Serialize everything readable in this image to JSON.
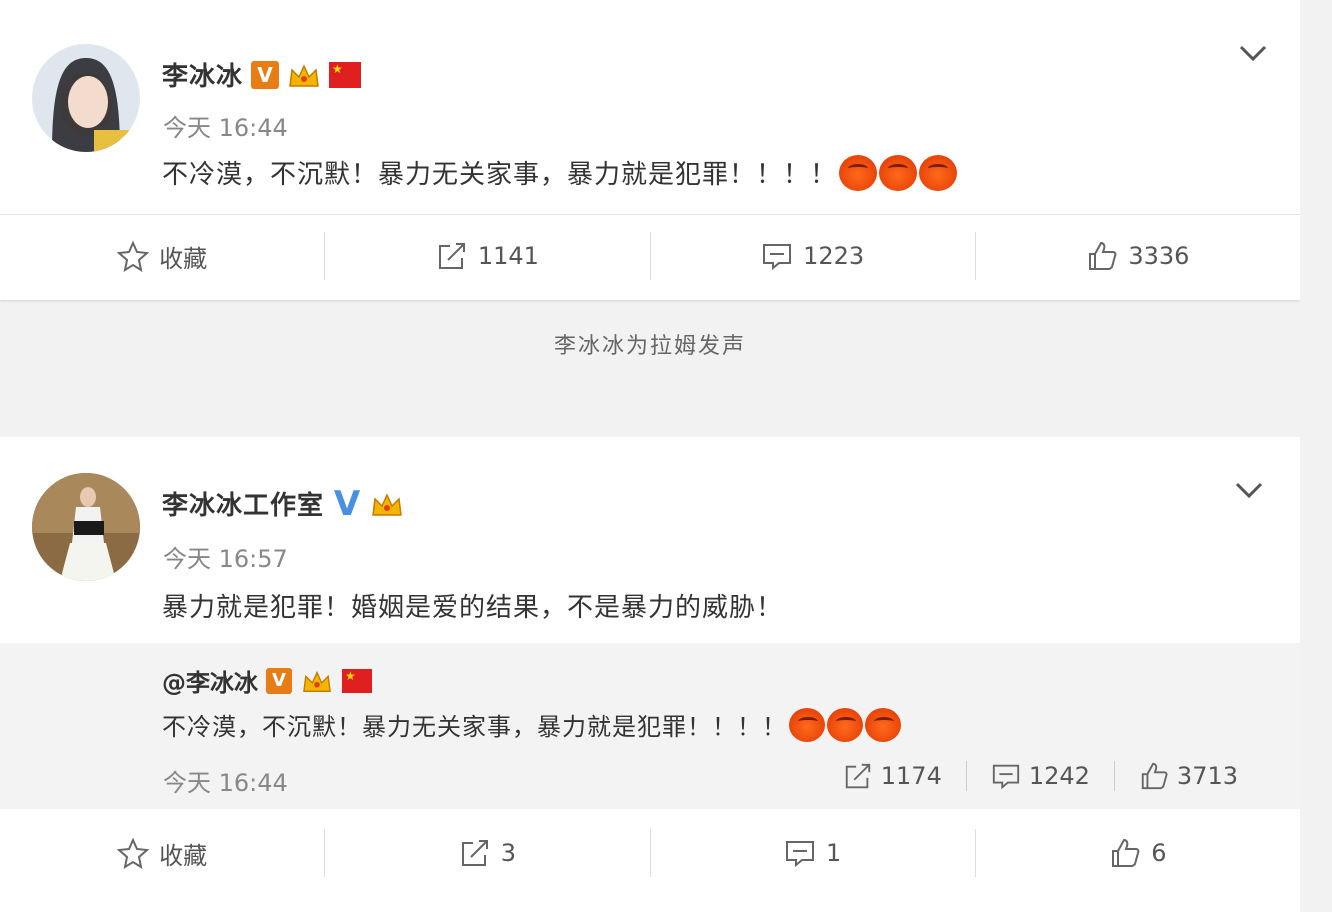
{
  "post1": {
    "author": "李冰冰",
    "time": "今天 16:44",
    "text": "不冷漠，不沉默！暴力无关家事，暴力就是犯罪！！！！",
    "emoji_count": 3,
    "actions": {
      "favorite": "收藏",
      "repost": "1141",
      "comment": "1223",
      "like": "3336"
    }
  },
  "caption": "李冰冰为拉姆发声",
  "post2": {
    "author": "李冰冰工作室",
    "time": "今天 16:57",
    "text": "暴力就是犯罪！婚姻是爱的结果，不是暴力的威胁！",
    "repost": {
      "author": "@李冰冰",
      "text": "不冷漠，不沉默！暴力无关家事，暴力就是犯罪！！！！",
      "time": "今天 16:44",
      "repost_count": "1174",
      "comment_count": "1242",
      "like_count": "3713"
    },
    "actions": {
      "favorite": "收藏",
      "repost": "3",
      "comment": "1",
      "like": "6"
    }
  },
  "colors": {
    "verified_orange": "#e87d15",
    "verified_blue": "#4a90e2",
    "flag_red": "#e02020"
  }
}
